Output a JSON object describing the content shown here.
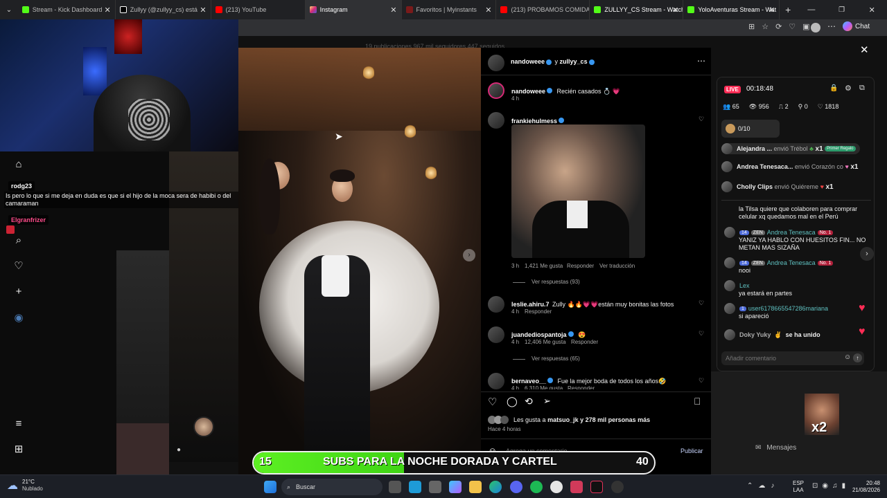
{
  "browser": {
    "tabs": [
      {
        "label": "Stream - Kick Dashboard",
        "color": "#53fc18"
      },
      {
        "label": "Zullyy (@zullyy_cs) está",
        "color": "#ffffff"
      },
      {
        "label": "(213) YouTube",
        "color": "#ff0000"
      },
      {
        "label": "Instagram",
        "color": "#e1306c"
      },
      {
        "label": "Favoritos | Myinstants",
        "color": "#c0392b"
      },
      {
        "label": "(213) PROBAMOS COMIDA",
        "color": "#ff0000"
      },
      {
        "label": "ZULLYY_CS Stream - Watch",
        "color": "#53fc18"
      },
      {
        "label": "YoloAventuras Stream - Wat",
        "color": "#53fc18"
      }
    ],
    "new_tab": "+",
    "chat_label": "Chat"
  },
  "ig": {
    "stats_overlay": "19 publicaciones   967 mil seguidores   447 seguidos",
    "post_header": {
      "user1": "nandoweee",
      "connector": "y",
      "user2": "zullyy_cs"
    },
    "caption": {
      "user": "nandoweee",
      "text": "Recién casados 💍 💗",
      "time": "4 h"
    },
    "comments": [
      {
        "user": "frankiehulmess",
        "text": "",
        "time": "3 h",
        "likes": "1,421 Me gusta",
        "reply": "Responder",
        "translate": "Ver traducción",
        "view_replies": "Ver respuestas (93)"
      },
      {
        "user": "leslie.ahiru.7",
        "text": "Zully 🔥🔥💗💗están muy bonitas las fotos",
        "time": "4 h",
        "reply": "Responder"
      },
      {
        "user": "juandediospantoja",
        "text": "😍",
        "time": "4 h",
        "likes": "12,406 Me gusta",
        "reply": "Responder",
        "view_replies": "Ver respuestas (65)"
      },
      {
        "user": "bernaveo__",
        "text": "Fue la mejor boda de todos los años🤣",
        "time": "4 h",
        "likes": "6,310 Me gusta",
        "reply": "Responder"
      }
    ],
    "likes_line": {
      "prefix": "Les gusta a",
      "user": "matsuo_jk",
      "suffix": "y 278 mil personas más"
    },
    "posted_ago": "Hace 4 horas",
    "add_comment_placeholder": "Agrega un comentario...",
    "publish": "Publicar",
    "close": "✕"
  },
  "overlay_chat": {
    "msg1_user": "rodg23",
    "msg1_text": "Is pero lo que si me deja en duda es que si el hijo de la moca sera de habibi o del camaraman",
    "msg2_user": "Elgranfrizer"
  },
  "live": {
    "badge": "LIVE",
    "timer": "00:18:48",
    "stats": {
      "a": "65",
      "b": "956",
      "c": "2",
      "d": "0",
      "e": "1818"
    },
    "goal": "0/10",
    "gifts": [
      {
        "user": "Alejandra ...",
        "action": "envió Trébol",
        "count": "x1",
        "tag": "Primer Regalo"
      },
      {
        "user": "Andrea Tenesaca...",
        "action": "envió Corazón co",
        "count": "x1"
      },
      {
        "user": "Cholly Clips",
        "action": "envió Quiéreme",
        "count": "x1"
      }
    ],
    "messages": [
      {
        "user": "",
        "text": "la Tilsa quiere que colaboren para comprar celular xq quedamos mal en el Perú"
      },
      {
        "user": "Andrea Tenesaca",
        "lvl": "14",
        "zen": "ZEN",
        "no1": "No. 1",
        "text": "YANIZ YA HABLO CON HUESITOS FIN... NO METAN MAS SIZAÑA"
      },
      {
        "user": "Andrea Tenesaca",
        "lvl": "14",
        "zen": "ZEN",
        "no1": "No. 1",
        "text": "nooi"
      },
      {
        "user": "Lex",
        "text": "ya estará en partes"
      },
      {
        "user": "user6178665547286mariana",
        "lvl": "1",
        "text": "si apareció"
      },
      {
        "user": "Doky Yuky",
        "text": "se ha unido"
      }
    ],
    "comment_placeholder": "Añadir comentario"
  },
  "x2_label": "x2",
  "messages_label": "Mensajes",
  "banner": {
    "left": "15",
    "text": "SUBS PARA LA NOCHE DORADA Y CARTEL",
    "right": "40",
    "progress": 0.375
  },
  "taskbar": {
    "weather_temp": "21°C",
    "weather_desc": "Nublado",
    "search": "Buscar",
    "lang1": "ESP",
    "lang2": "LAA",
    "time": "20:48",
    "date": "21/08/2026"
  }
}
